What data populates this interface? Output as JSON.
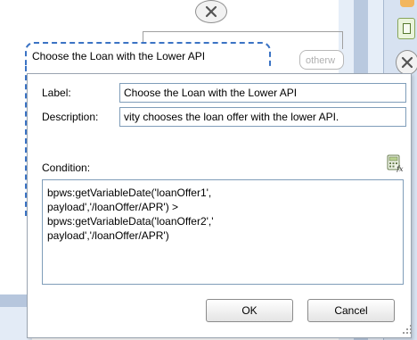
{
  "background": {
    "chip_text": "otherw",
    "icons": {
      "top_close": "close-circle-icon",
      "right_close": "close-circle-icon",
      "right_tool": "calculator-icon"
    }
  },
  "callout": {
    "title": "Choose the Loan with the Lower API"
  },
  "dialog": {
    "label_field": {
      "label": "Label:",
      "value": "Choose the Loan with the Lower API"
    },
    "description_field": {
      "label": "Description:",
      "value": "vity chooses the loan offer with the lower API."
    },
    "condition": {
      "label": "Condition:",
      "icon": "expression-builder-icon",
      "lines": [
        "bpws:getVariableDate('loanOffer1',",
        "payload','/loanOffer/APR') >",
        "bpws:getVariableData('loanOffer2','",
        "payload','/loanOffer/APR')"
      ]
    },
    "buttons": {
      "ok": "OK",
      "cancel": "Cancel"
    }
  },
  "colors": {
    "callout_border": "#3b73c4",
    "field_border": "#7f9db9"
  }
}
